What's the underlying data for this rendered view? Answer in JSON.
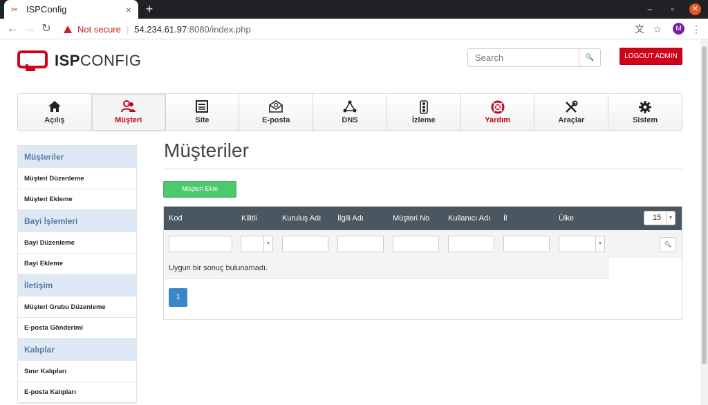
{
  "browser": {
    "tab_title": "ISPConfig",
    "tab_close": "×",
    "new_tab": "+",
    "minimize": "–",
    "restore": "▫",
    "close": "✕",
    "not_secure": "Not secure",
    "url_host": "54.234.61.97",
    "url_rest": ":8080/index.php",
    "profile_initial": "M"
  },
  "header": {
    "logo_bold": "ISP",
    "logo_light": "CONFIG",
    "search_placeholder": "Search",
    "logout_label": "LOGOUT ADMIN"
  },
  "nav": {
    "items": [
      {
        "label": "Açılış",
        "icon": "home-icon"
      },
      {
        "label": "Müşteri",
        "icon": "users-icon"
      },
      {
        "label": "Site",
        "icon": "site-icon"
      },
      {
        "label": "E-posta",
        "icon": "mail-icon"
      },
      {
        "label": "DNS",
        "icon": "dns-icon"
      },
      {
        "label": "İzleme",
        "icon": "traffic-light-icon"
      },
      {
        "label": "Yardım",
        "icon": "lifebuoy-icon"
      },
      {
        "label": "Araçlar",
        "icon": "tools-icon"
      },
      {
        "label": "Sistem",
        "icon": "gear-icon"
      }
    ]
  },
  "sidebar": {
    "sections": [
      {
        "title": "Müşteriler",
        "items": [
          "Müşteri Düzenleme",
          "Müşteri Ekleme"
        ]
      },
      {
        "title": "Bayi İşlemleri",
        "items": [
          "Bayi Düzenleme",
          "Bayi Ekleme"
        ]
      },
      {
        "title": "İletişim",
        "items": [
          "Müşteri Grubu Düzenleme",
          "E-posta Gönderimi"
        ]
      },
      {
        "title": "Kalıplar",
        "items": [
          "Sınır Kalıpları",
          "E-posta Kalıpları"
        ]
      }
    ]
  },
  "main": {
    "title": "Müşteriler",
    "add_button": "Müşteri Ekle",
    "table": {
      "columns": [
        "Kod",
        "Kilitli",
        "Kuruluş Adı",
        "İlgili Adı",
        "Müşteri No",
        "Kullanıcı Adı",
        "İl",
        "Ülke"
      ],
      "per_page": "15",
      "empty_message": "Uygun bir sonuç bulunamadı.",
      "page": "1"
    }
  },
  "colors": {
    "accent_red": "#d0021b",
    "nav_active_red": "#c0061c",
    "add_green": "#4cc96e",
    "grid_header": "#4a5660",
    "pager_blue": "#3a87c8",
    "sidebar_section": "#dfe9f5"
  }
}
